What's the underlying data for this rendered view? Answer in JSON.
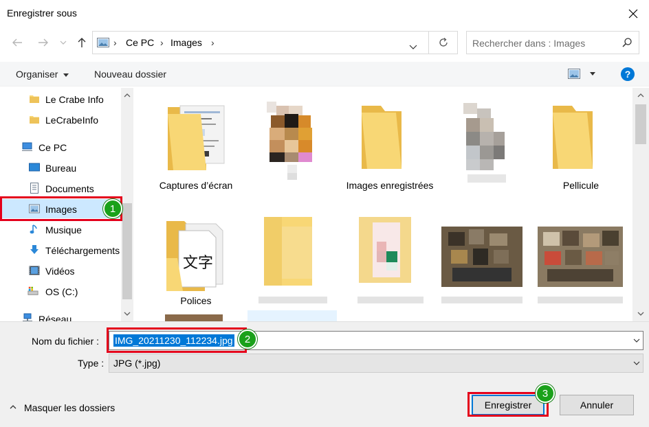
{
  "window": {
    "title": "Enregistrer sous"
  },
  "address": {
    "crumbs": [
      "Ce PC",
      "Images"
    ],
    "search_placeholder": "Rechercher dans : Images"
  },
  "toolbar": {
    "organize": "Organiser",
    "new_folder": "Nouveau dossier",
    "help": "?"
  },
  "nav": {
    "items": [
      {
        "label": "Le Crabe Info",
        "icon": "folder-icon"
      },
      {
        "label": "LeCrabeInfo",
        "icon": "folder-icon"
      },
      {
        "label": "Ce PC",
        "icon": "computer-icon"
      },
      {
        "label": "Bureau",
        "icon": "desktop-icon"
      },
      {
        "label": "Documents",
        "icon": "documents-icon"
      },
      {
        "label": "Images",
        "icon": "pictures-icon",
        "selected": true
      },
      {
        "label": "Musique",
        "icon": "music-icon"
      },
      {
        "label": "Téléchargements",
        "icon": "downloads-icon"
      },
      {
        "label": "Vidéos",
        "icon": "videos-icon"
      },
      {
        "label": "OS (C:)",
        "icon": "drive-icon"
      },
      {
        "label": "Réseau",
        "icon": "network-icon"
      }
    ]
  },
  "content": {
    "tiles": [
      {
        "label": "Captures d’écran"
      },
      {
        "label": "Images enregistrées"
      },
      {
        "label": "Pellicule"
      },
      {
        "label": "Polices"
      }
    ]
  },
  "form": {
    "filename_label": "Nom du fichier :",
    "filename_value": "IMG_20211230_112234.jpg",
    "type_label": "Type :",
    "type_value": "JPG (*.jpg)"
  },
  "footer": {
    "hide_folders": "Masquer les dossiers",
    "save": "Enregistrer",
    "cancel": "Annuler"
  },
  "annotations": {
    "badge1": "1",
    "badge2": "2",
    "badge3": "3"
  },
  "colors": {
    "accent": "#0078d7",
    "annotation_red": "#e4001b",
    "badge_green": "#1aa11a",
    "folder": "#f8d775"
  }
}
